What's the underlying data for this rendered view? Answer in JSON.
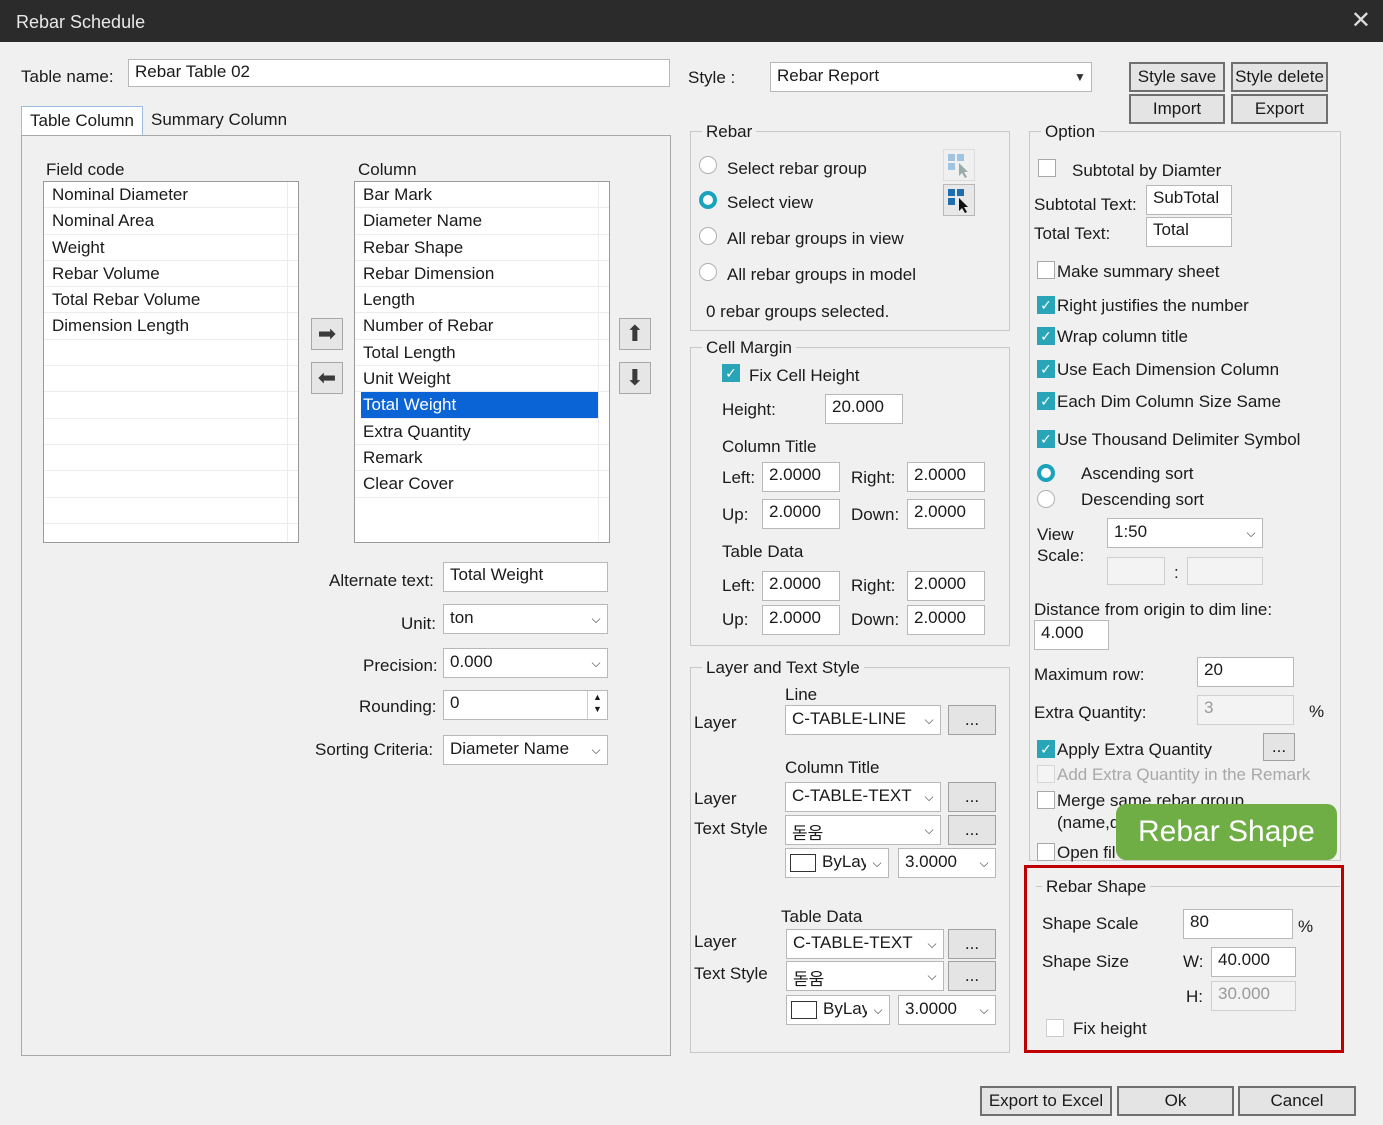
{
  "window": {
    "title": "Rebar Schedule",
    "close_glyph": "✕"
  },
  "table_name": {
    "label": "Table name:",
    "value": "Rebar Table 02"
  },
  "style": {
    "label": "Style :",
    "value": "Rebar Report"
  },
  "buttons": {
    "style_save": "Style save",
    "style_delete": "Style delete",
    "import": "Import",
    "export": "Export",
    "export_excel": "Export to Excel",
    "ok": "Ok",
    "cancel": "Cancel"
  },
  "tabs": [
    "Table Column",
    "Summary Column"
  ],
  "field_code": {
    "label": "Field code",
    "items": [
      "Nominal Diameter",
      "Nominal Area",
      "Weight",
      "Rebar Volume",
      "Total Rebar Volume",
      "Dimension Length"
    ]
  },
  "column": {
    "label": "Column",
    "items": [
      "Bar Mark",
      "Diameter Name",
      "Rebar Shape",
      "Rebar Dimension",
      "Length",
      "Number of Rebar",
      "Total Length",
      "Unit Weight",
      "Total Weight",
      "Extra Quantity",
      "Remark",
      "Clear Cover"
    ],
    "selected_index": 8
  },
  "props": {
    "alternate_text": {
      "label": "Alternate text:",
      "value": "Total Weight"
    },
    "unit": {
      "label": "Unit:",
      "value": "ton"
    },
    "precision": {
      "label": "Precision:",
      "value": "0.000"
    },
    "rounding": {
      "label": "Rounding:",
      "value": "0"
    },
    "sorting": {
      "label": "Sorting Criteria:",
      "value": "Diameter Name"
    }
  },
  "rebar": {
    "title": "Rebar",
    "options": [
      "Select rebar group",
      "Select view",
      "All rebar groups in view",
      "All rebar groups in model"
    ],
    "selected_index": 1,
    "status": "0 rebar groups selected."
  },
  "cell_margin": {
    "title": "Cell Margin",
    "fix_cell_height": "Fix Cell Height",
    "height": {
      "label": "Height:",
      "value": "20.000"
    },
    "column_title": "Column Title",
    "table_data": "Table Data",
    "left_label": "Left:",
    "right_label": "Right:",
    "up_label": "Up:",
    "down_label": "Down:",
    "ct_left": "2.0000",
    "ct_right": "2.0000",
    "ct_up": "2.0000",
    "ct_down": "2.0000",
    "td_left": "2.0000",
    "td_right": "2.0000",
    "td_up": "2.0000",
    "td_down": "2.0000"
  },
  "layer_text": {
    "title": "Layer and Text Style",
    "line": "Line",
    "layer_label": "Layer",
    "text_style_label": "Text Style",
    "line_layer": "C-TABLE-LINE",
    "column_title": "Column Title",
    "ct_layer": "C-TABLE-TEXT",
    "ct_style": "돋움",
    "ct_color": "ByLayer",
    "ct_size": "3.0000",
    "table_data": "Table Data",
    "td_layer": "C-TABLE-TEXT",
    "td_style": "돋움",
    "td_color": "ByLayer",
    "td_size": "3.0000",
    "ellipsis": "..."
  },
  "option": {
    "title": "Option",
    "subtotal_by_diameter": "Subtotal by Diamter",
    "subtotal_text": {
      "label": "Subtotal Text:",
      "value": "SubTotal"
    },
    "total_text": {
      "label": "Total Text:",
      "value": "Total"
    },
    "make_summary": "Make summary sheet",
    "right_justify": "Right justifies the number",
    "wrap_title": "Wrap column title",
    "each_dim_column": "Use Each Dimension Column",
    "each_dim_size": "Each Dim Column Size Same",
    "thousand": "Use Thousand Delimiter Symbol",
    "ascending": "Ascending sort",
    "descending": "Descending sort",
    "view_scale_label_1": "View",
    "view_scale_label_2": "Scale:",
    "view_scale": "1:50",
    "scale_sep": ":",
    "distance": {
      "label": "Distance from origin to dim line:",
      "value": "4.000"
    },
    "max_row": {
      "label": "Maximum row:",
      "value": "20"
    },
    "extra_qty": {
      "label": "Extra Quantity:",
      "value": "3",
      "unit": "%"
    },
    "apply_extra": "Apply Extra Quantity",
    "add_extra_remark": "Add Extra Quantity in the Remark",
    "merge_1": "Merge same rebar group",
    "merge_2": "(name,d",
    "open_file": "Open fil"
  },
  "rebar_shape": {
    "title": "Rebar Shape",
    "scale": {
      "label": "Shape Scale",
      "value": "80",
      "unit": "%"
    },
    "size_label": "Shape Size",
    "w_label": "W:",
    "w_value": "40.000",
    "h_label": "H:",
    "h_value": "30.000",
    "fix_height": "Fix height"
  },
  "callout": {
    "text": "Rebar Shape"
  },
  "icons": {
    "arrow_right": "➡",
    "arrow_left": "⬅",
    "arrow_up": "⬆",
    "arrow_down": "⬇",
    "chevron": "⌵",
    "check": "✓"
  }
}
